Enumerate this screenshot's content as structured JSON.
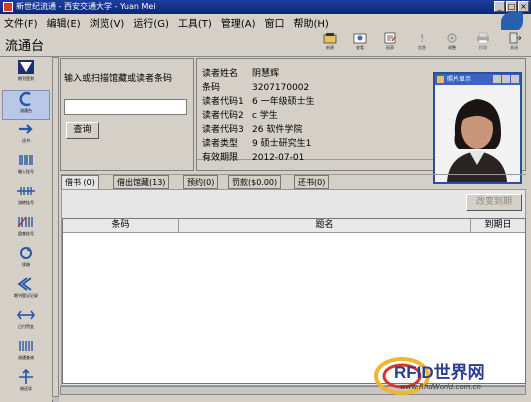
{
  "window": {
    "title": "新世纪流通 - 西安交通大学 - Yuan Mei"
  },
  "menu": [
    "文件(F)",
    "编辑(E)",
    "浏览(V)",
    "运行(G)",
    "工具(T)",
    "管理(A)",
    "窗口",
    "帮助(H)"
  ],
  "app_title": "流通台",
  "toolbar": [
    "新建",
    "查看",
    "报表",
    "信息",
    "调整",
    "打印",
    "关闭"
  ],
  "sidebar": [
    "期刊签到",
    "流通台",
    "还书",
    "输入挂号",
    "流转挂号",
    "盘查挂号",
    "续借",
    "期刊登记记录",
    "已付罚金",
    "流通查询",
    "借还导"
  ],
  "search": {
    "label": "输入或扫描馆藏或读者条码",
    "value": "",
    "button": "查询"
  },
  "reader": [
    {
      "label": "读者姓名",
      "value": "阴慧辉"
    },
    {
      "label": "条码",
      "value": "3207170002"
    },
    {
      "label": "读者代码1",
      "value": "6 一年级硕士生"
    },
    {
      "label": "读者代码2",
      "value": "c 学生"
    },
    {
      "label": "读者代码3",
      "value": "26 软件学院"
    },
    {
      "label": "读者类型",
      "value": "9 硕士研究生1"
    },
    {
      "label": "有效期限",
      "value": "2012-07-01"
    }
  ],
  "tabs": [
    "借书 (0)",
    "借出馆藏(13)",
    "预约(0)",
    "罚款($0.00)",
    "还书(0)"
  ],
  "renew_button": "改变到期",
  "table_headers": [
    "条码",
    "题名",
    "到期日"
  ],
  "photo_window": {
    "title": "照片显示"
  },
  "watermark": {
    "brand": "RFID世界网",
    "url": "www.RfidWorld.com.cn"
  }
}
